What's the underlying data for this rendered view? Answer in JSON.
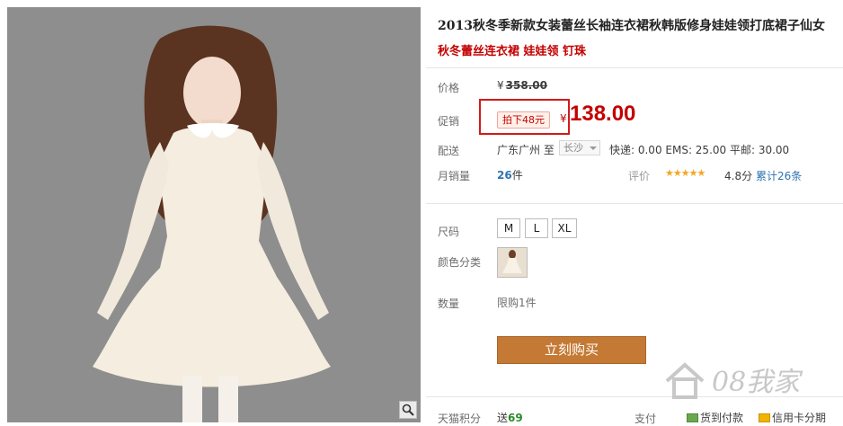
{
  "product": {
    "title": "2013秋冬季新款女装蕾丝长袖连衣裙秋韩版修身娃娃领打底裙子仙女",
    "subtitle": "秋冬蕾丝连衣裙 娃娃领 钉珠"
  },
  "price": {
    "label": "价格",
    "currency": "¥",
    "original": "358.00"
  },
  "promo": {
    "label": "促销",
    "tag": "拍下48元",
    "currency": "¥",
    "price": "138.00"
  },
  "shipping": {
    "label": "配送",
    "from": "广东广州 至",
    "destination": "长沙",
    "fees": "快递: 0.00 EMS: 25.00 平邮: 30.00"
  },
  "sales": {
    "label": "月销量",
    "count": "26",
    "unit": "件"
  },
  "reviews": {
    "label": "评价",
    "stars": "★★★★★",
    "rating_value": 4.8,
    "score": "4.8分",
    "count_text": "累计26条"
  },
  "size": {
    "label": "尺码",
    "options": [
      "M",
      "L",
      "XL"
    ]
  },
  "color": {
    "label": "颜色分类"
  },
  "quantity": {
    "label": "数量",
    "limit": "限购1件"
  },
  "buy_button": "立刻购买",
  "points": {
    "label": "天猫积分",
    "prefix": "送",
    "value": "69"
  },
  "payment": {
    "label": "支付",
    "methods": [
      "货到付款",
      "信用卡分期"
    ]
  },
  "watermark": "08我家",
  "icons": {
    "zoom": "magnifier-icon",
    "dropdown": "chevron-down-icon",
    "cod": "cod-icon",
    "credit": "credit-card-icon"
  },
  "colors": {
    "promo_red": "#c40000",
    "buy_button": "#c47a34",
    "link_blue": "#2f74b0",
    "star": "#f5a623"
  }
}
